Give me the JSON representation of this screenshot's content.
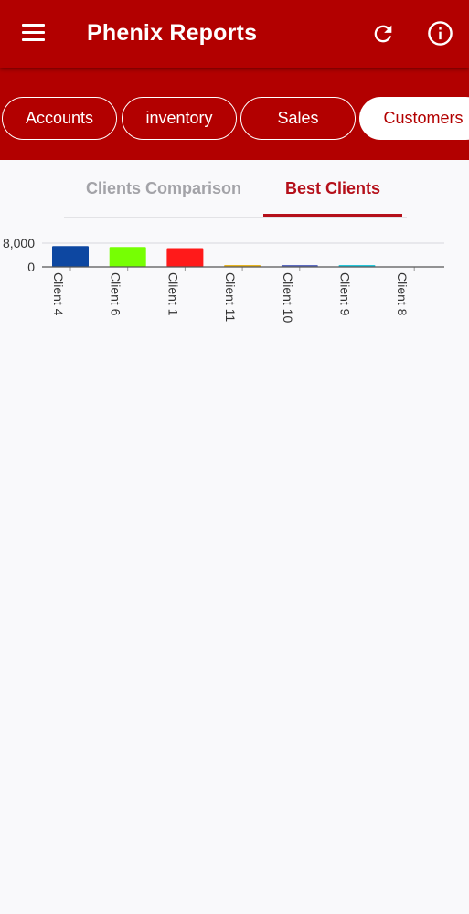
{
  "header": {
    "title": "Phenix Reports",
    "menu_icon": "menu-icon",
    "refresh_icon": "refresh-icon",
    "info_icon": "info-icon",
    "color": "#b20000"
  },
  "categories": [
    {
      "label": "Accounts",
      "active": false
    },
    {
      "label": "inventory",
      "active": false
    },
    {
      "label": "Sales",
      "active": false
    },
    {
      "label": "Customers",
      "active": true
    }
  ],
  "subtabs": [
    {
      "label": "Clients Comparison",
      "active": false
    },
    {
      "label": "Best Clients",
      "active": true
    }
  ],
  "chart_data": {
    "type": "bar",
    "categories": [
      "Client 4",
      "Client 6",
      "Client 1",
      "Client 11",
      "Client 10",
      "Client 9",
      "Client 8"
    ],
    "values": [
      7000,
      6700,
      6300,
      600,
      400,
      100,
      0
    ],
    "colors": [
      "#0d47a1",
      "#76ff03",
      "#ff1a1a",
      "#e6b422",
      "#5c6bc0",
      "#26c6da",
      "#8d6e63"
    ],
    "y_ticks": [
      "8,000",
      "0"
    ],
    "ylim": [
      0,
      8000
    ],
    "grid": true,
    "title": "",
    "xlabel": "",
    "ylabel": ""
  }
}
